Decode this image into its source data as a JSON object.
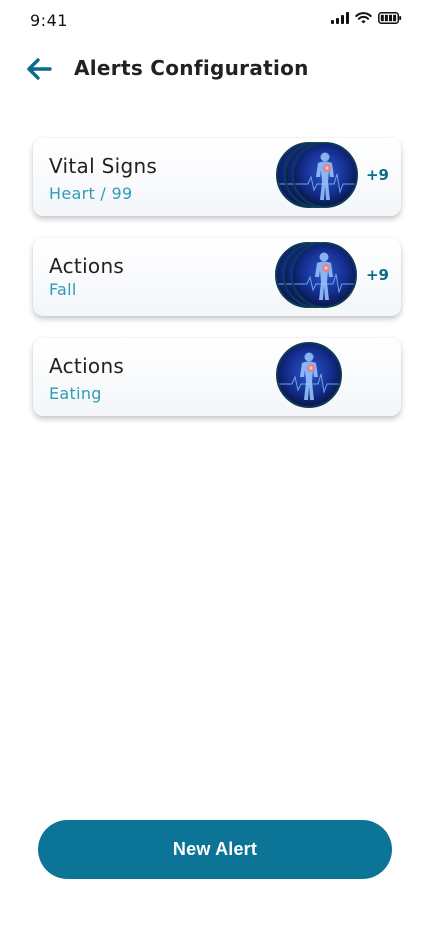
{
  "status_bar": {
    "time": "9:41"
  },
  "header": {
    "back_icon": "arrow-left-icon",
    "title": "Alerts Configuration"
  },
  "alerts": [
    {
      "title": "Vital Signs",
      "subtitle": "Heart / 99",
      "extra_count": "+9",
      "avatar_icon": "body-scan-icon"
    },
    {
      "title": "Actions",
      "subtitle": "Fall",
      "extra_count": "+9",
      "avatar_icon": "body-scan-icon"
    },
    {
      "title": "Actions",
      "subtitle": "Eating",
      "extra_count": "",
      "avatar_icon": "body-scan-icon"
    }
  ],
  "footer": {
    "new_alert_label": "New Alert"
  },
  "colors": {
    "accent": "#0c7497",
    "subtitle": "#2f9bb5",
    "count": "#0c6a8a"
  }
}
